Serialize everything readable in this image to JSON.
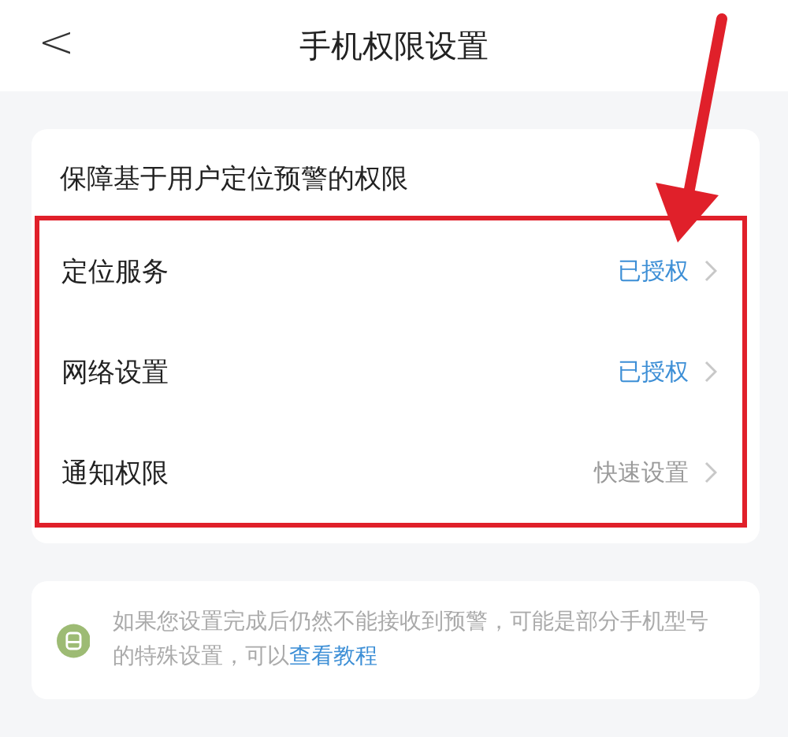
{
  "header": {
    "back": "<",
    "title": "手机权限设置"
  },
  "section": {
    "title": "保障基于用户定位预警的权限",
    "highlighted": true,
    "rows": [
      {
        "label": "定位服务",
        "status": "已授权",
        "kind": "granted"
      },
      {
        "label": "网络设置",
        "status": "已授权",
        "kind": "granted"
      },
      {
        "label": "通知权限",
        "status": "快速设置",
        "kind": "action"
      }
    ]
  },
  "tip": {
    "text": "如果您设置完成后仍然不能接收到预警，可能是部分手机型号的特殊设置，可以",
    "link": "查看教程"
  },
  "annotation": {
    "kind": "arrow"
  }
}
